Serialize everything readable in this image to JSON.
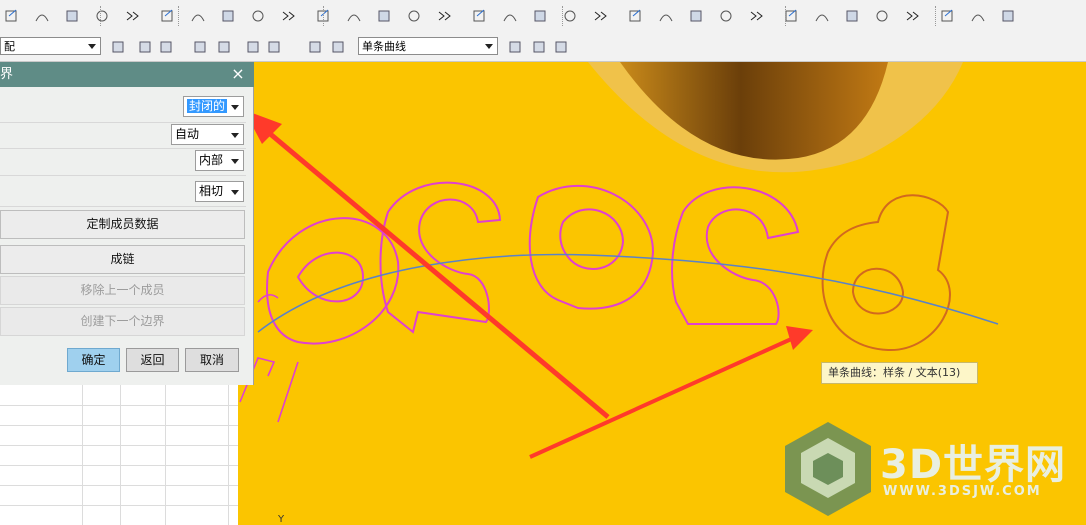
{
  "toolbar": {
    "row1_icons": [
      "sketch-icon",
      "curve-icon",
      "offset-icon",
      "pattern-icon",
      "more-icon",
      "sweep-icon",
      "extrude-icon",
      "revolve-icon",
      "trim-icon",
      "blend-icon",
      "hole-icon",
      "boss-icon",
      "pocket-icon",
      "feature-icon",
      "line-icon",
      "arc-icon",
      "point-icon",
      "datum-icon",
      "project-icon",
      "intersect-icon",
      "bridge-icon",
      "fit-icon",
      "spline-icon",
      "surface-icon",
      "mesh-icon",
      "render-icon",
      "view-icon",
      "filter-icon",
      "snap-icon",
      "point-snap-icon",
      "arrow-icon",
      "hide-icon",
      "show-icon"
    ],
    "filter_dropdown": "配",
    "curve_rule_dropdown": "单条曲线"
  },
  "dialog": {
    "title": "界",
    "close_label": "×",
    "type_value": "封闭的",
    "mode_value": "自动",
    "inner_value": "内部",
    "tangent_value": "相切",
    "buttons": {
      "custom_member_data": "定制成员数据",
      "chain": "成链",
      "remove_last_member": "移除上一个成员",
      "create_next_boundary": "创建下一个边界"
    },
    "ok": "确定",
    "back": "返回",
    "cancel": "取消"
  },
  "viewport": {
    "text_glyphs": [
      "9",
      "6",
      "9",
      "6",
      "6"
    ],
    "tooltip": "单条曲线：样条 / 文本(13)",
    "axis_label": "Y"
  },
  "watermark": {
    "brand": "3D世界网",
    "url": "WWW.3DSJW.COM"
  },
  "colors": {
    "viewport_bg": "#fbc500",
    "outline_magenta": "#e040d0",
    "outline_orange": "#d2691e",
    "spline_blue": "#5a82c8",
    "arrow_red": "#ff3a2a",
    "dialog_title_bg": "#5f8c86",
    "ok_button": "#9fd0ee"
  }
}
